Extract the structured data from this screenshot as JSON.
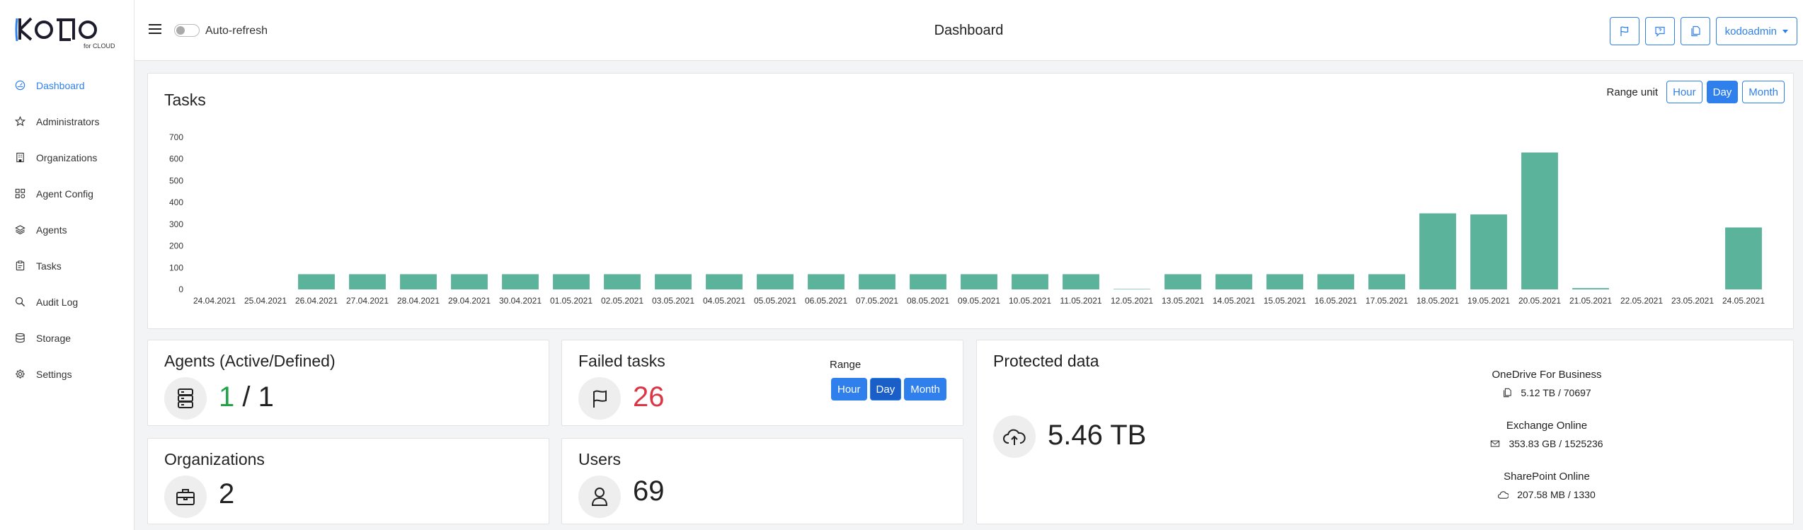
{
  "app": {
    "logo_text": "KOƆO",
    "logo_sub": "for CLOUD"
  },
  "sidebar": {
    "items": [
      {
        "label": "Dashboard",
        "icon": "dashboard-icon",
        "active": true
      },
      {
        "label": "Administrators",
        "icon": "star-icon",
        "active": false
      },
      {
        "label": "Organizations",
        "icon": "building-icon",
        "active": false
      },
      {
        "label": "Agent Config",
        "icon": "grid-icon",
        "active": false
      },
      {
        "label": "Agents",
        "icon": "layers-icon",
        "active": false
      },
      {
        "label": "Tasks",
        "icon": "clipboard-icon",
        "active": false
      },
      {
        "label": "Audit Log",
        "icon": "search-icon",
        "active": false
      },
      {
        "label": "Storage",
        "icon": "database-icon",
        "active": false
      },
      {
        "label": "Settings",
        "icon": "gear-icon",
        "active": false
      }
    ]
  },
  "topbar": {
    "auto_refresh_label": "Auto-refresh",
    "title": "Dashboard",
    "user_label": "kodoadmin"
  },
  "tasks_card": {
    "title": "Tasks",
    "range_unit_label": "Range unit",
    "range_options": [
      "Hour",
      "Day",
      "Month"
    ],
    "selected": "Day"
  },
  "chart_data": {
    "type": "bar",
    "color": "#5bb39b",
    "categories": [
      "24.04.2021",
      "25.04.2021",
      "26.04.2021",
      "27.04.2021",
      "28.04.2021",
      "29.04.2021",
      "30.04.2021",
      "01.05.2021",
      "02.05.2021",
      "03.05.2021",
      "04.05.2021",
      "05.05.2021",
      "06.05.2021",
      "07.05.2021",
      "08.05.2021",
      "09.05.2021",
      "10.05.2021",
      "11.05.2021",
      "12.05.2021",
      "13.05.2021",
      "14.05.2021",
      "15.05.2021",
      "16.05.2021",
      "17.05.2021",
      "18.05.2021",
      "19.05.2021",
      "20.05.2021",
      "21.05.2021",
      "22.05.2021",
      "23.05.2021",
      "24.05.2021"
    ],
    "values": [
      0,
      0,
      70,
      70,
      70,
      70,
      70,
      70,
      70,
      70,
      70,
      70,
      70,
      70,
      70,
      70,
      70,
      70,
      2,
      70,
      70,
      70,
      70,
      70,
      350,
      345,
      630,
      6,
      0,
      0,
      285
    ],
    "yticks": [
      0,
      100,
      200,
      300,
      400,
      500,
      600,
      700
    ],
    "ylim": [
      0,
      700
    ],
    "grid": false,
    "title": "",
    "xlabel": "",
    "ylabel": ""
  },
  "agents_card": {
    "title": "Agents (Active/Defined)",
    "active": "1",
    "separator": "/",
    "defined": "1",
    "icon": "server-icon"
  },
  "failed_card": {
    "title": "Failed tasks",
    "value": "26",
    "range_label": "Range",
    "range_options": [
      "Hour",
      "Day",
      "Month"
    ],
    "selected": "Day",
    "icon": "flag-icon"
  },
  "orgs_card": {
    "title": "Organizations",
    "value": "2",
    "icon": "briefcase-icon"
  },
  "users_card": {
    "title": "Users",
    "value": "69",
    "icon": "user-icon"
  },
  "protected_card": {
    "title": "Protected data",
    "total": "5.46 TB",
    "icon": "cloud-upload-icon",
    "services": [
      {
        "name": "OneDrive For Business",
        "value": "5.12 TB / 70697",
        "icon": "files-icon"
      },
      {
        "name": "Exchange Online",
        "value": "353.83 GB / 1525236",
        "icon": "mail-icon"
      },
      {
        "name": "SharePoint Online",
        "value": "207.58 MB / 1330",
        "icon": "cloud-icon"
      }
    ]
  },
  "colors": {
    "accent": "#2f80ed",
    "green": "#22a34a",
    "red": "#dc3545",
    "bar": "#5bb39b"
  }
}
